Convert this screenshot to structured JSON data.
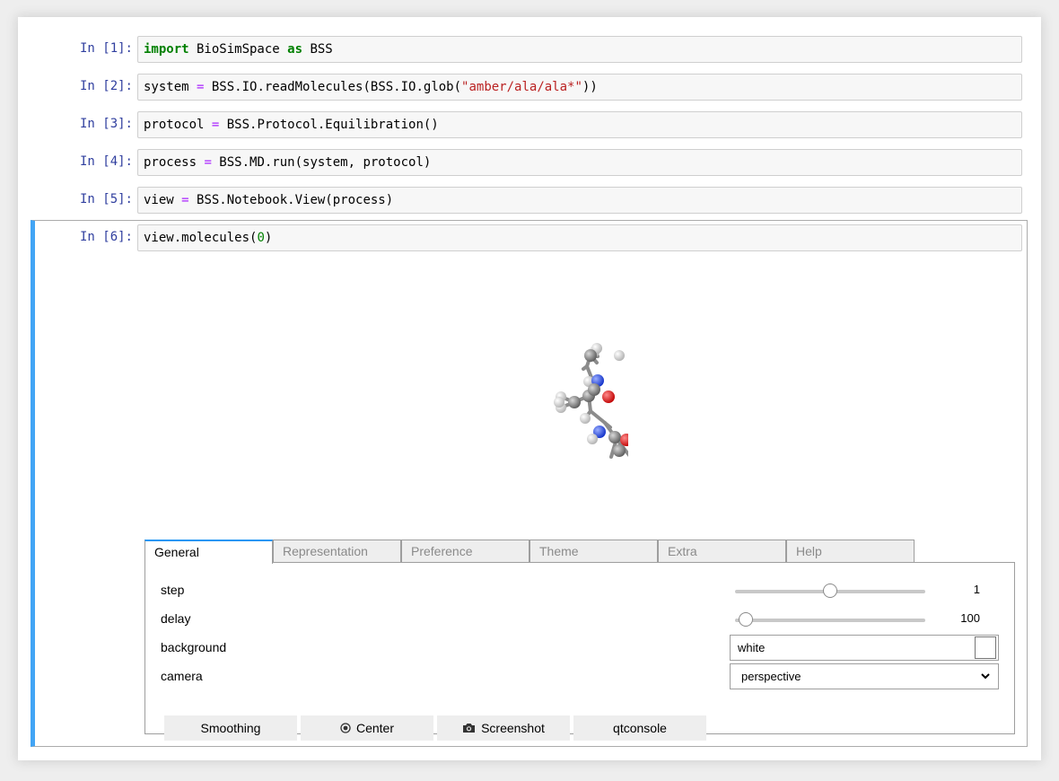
{
  "cells": [
    {
      "prompt": "In [1]:",
      "code": [
        {
          "t": "import",
          "c": "kw"
        },
        {
          "t": " BioSimSpace ",
          "c": ""
        },
        {
          "t": "as",
          "c": "kw"
        },
        {
          "t": " BSS",
          "c": ""
        }
      ]
    },
    {
      "prompt": "In [2]:",
      "code": [
        {
          "t": "system ",
          "c": ""
        },
        {
          "t": "=",
          "c": "op"
        },
        {
          "t": " BSS.IO.readMolecules(BSS.IO.glob(",
          "c": ""
        },
        {
          "t": "\"amber/ala/ala*\"",
          "c": "str"
        },
        {
          "t": "))",
          "c": ""
        }
      ]
    },
    {
      "prompt": "In [3]:",
      "code": [
        {
          "t": "protocol ",
          "c": ""
        },
        {
          "t": "=",
          "c": "op"
        },
        {
          "t": " BSS.Protocol.Equilibration()",
          "c": ""
        }
      ]
    },
    {
      "prompt": "In [4]:",
      "code": [
        {
          "t": "process ",
          "c": ""
        },
        {
          "t": "=",
          "c": "op"
        },
        {
          "t": " BSS.MD.run(system, protocol)",
          "c": ""
        }
      ]
    },
    {
      "prompt": "In [5]:",
      "code": [
        {
          "t": "view ",
          "c": ""
        },
        {
          "t": "=",
          "c": "op"
        },
        {
          "t": " BSS.Notebook.View(process)",
          "c": ""
        }
      ]
    },
    {
      "prompt": "In [6]:",
      "code": [
        {
          "t": "view.molecules(",
          "c": ""
        },
        {
          "t": "0",
          "c": "num"
        },
        {
          "t": ")",
          "c": ""
        }
      ]
    }
  ],
  "widget": {
    "tabs": [
      "General",
      "Representation",
      "Preference",
      "Theme",
      "Extra",
      "Help"
    ],
    "active_tab": "General",
    "step": {
      "label": "step",
      "value": "1",
      "fraction": 0.5
    },
    "delay": {
      "label": "delay",
      "value": "100",
      "fraction": 0.0
    },
    "background": {
      "label": "background",
      "value": "white",
      "swatch_color": "#ffffff"
    },
    "camera": {
      "label": "camera",
      "value": "perspective"
    },
    "buttons": {
      "smoothing": "Smoothing",
      "center": "Center",
      "screenshot": "Screenshot",
      "qtconsole": "qtconsole"
    }
  },
  "colors": {
    "prompt": "#303f9f",
    "selected_bar": "#42a5f5",
    "carbon": "#8c8c8c",
    "nitrogen": "#3050f8",
    "oxygen": "#ff0d0d",
    "hydrogen": "#f2f2f2"
  }
}
